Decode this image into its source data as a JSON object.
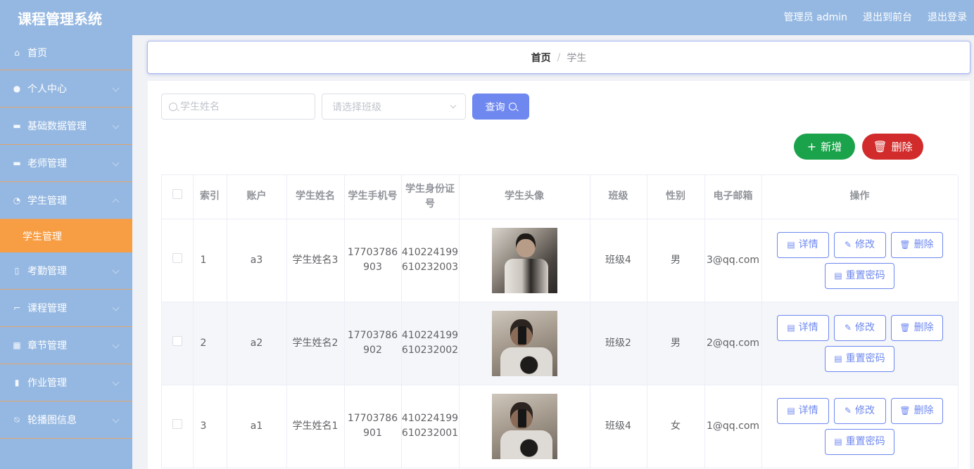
{
  "app": {
    "title": "课程管理系统"
  },
  "header": {
    "admin_label": "管理员 admin",
    "to_front": "退出到前台",
    "logout": "退出登录"
  },
  "sidebar": {
    "items": [
      {
        "label": "首页",
        "icon": "home-icon"
      },
      {
        "label": "个人中心",
        "icon": "user-icon"
      },
      {
        "label": "基础数据管理",
        "icon": "ticket-icon"
      },
      {
        "label": "老师管理",
        "icon": "briefcase-icon"
      },
      {
        "label": "学生管理",
        "icon": "dashboard-icon"
      },
      {
        "label": "考勤管理",
        "icon": "microphone-icon"
      },
      {
        "label": "课程管理",
        "icon": "crop-icon"
      },
      {
        "label": "章节管理",
        "icon": "grid-icon"
      },
      {
        "label": "作业管理",
        "icon": "notebook-icon"
      },
      {
        "label": "轮播图信息",
        "icon": "bell-off-icon"
      }
    ],
    "active_sub": "学生管理"
  },
  "breadcrumb": {
    "home": "首页",
    "sep": "/",
    "current": "学生"
  },
  "search": {
    "name_placeholder": "学生姓名",
    "class_placeholder": "请选择班级",
    "query_label": "查询"
  },
  "actions": {
    "add": "新增",
    "delete": "删除"
  },
  "table": {
    "headers": [
      "索引",
      "账户",
      "学生姓名",
      "学生手机号",
      "学生身份证号",
      "学生头像",
      "班级",
      "性别",
      "电子邮箱",
      "操作"
    ],
    "rows": [
      {
        "index": "1",
        "account": "a3",
        "name": "学生姓名3",
        "phone": "17703786903",
        "id_card": "410224199610232003",
        "class": "班级4",
        "gender": "男",
        "email": "3@qq.com"
      },
      {
        "index": "2",
        "account": "a2",
        "name": "学生姓名2",
        "phone": "17703786902",
        "id_card": "410224199610232002",
        "class": "班级2",
        "gender": "男",
        "email": "2@qq.com"
      },
      {
        "index": "3",
        "account": "a1",
        "name": "学生姓名1",
        "phone": "17703786901",
        "id_card": "410224199610232001",
        "class": "班级4",
        "gender": "女",
        "email": "1@qq.com"
      }
    ],
    "ops": {
      "detail": "详情",
      "edit": "修改",
      "delete": "删除",
      "reset": "重置密码"
    }
  },
  "colors": {
    "header_bg": "#95b8e2",
    "active_menu": "#f79d44",
    "primary": "#6e88f0",
    "success": "#1aa34a",
    "danger": "#d22b2b"
  }
}
